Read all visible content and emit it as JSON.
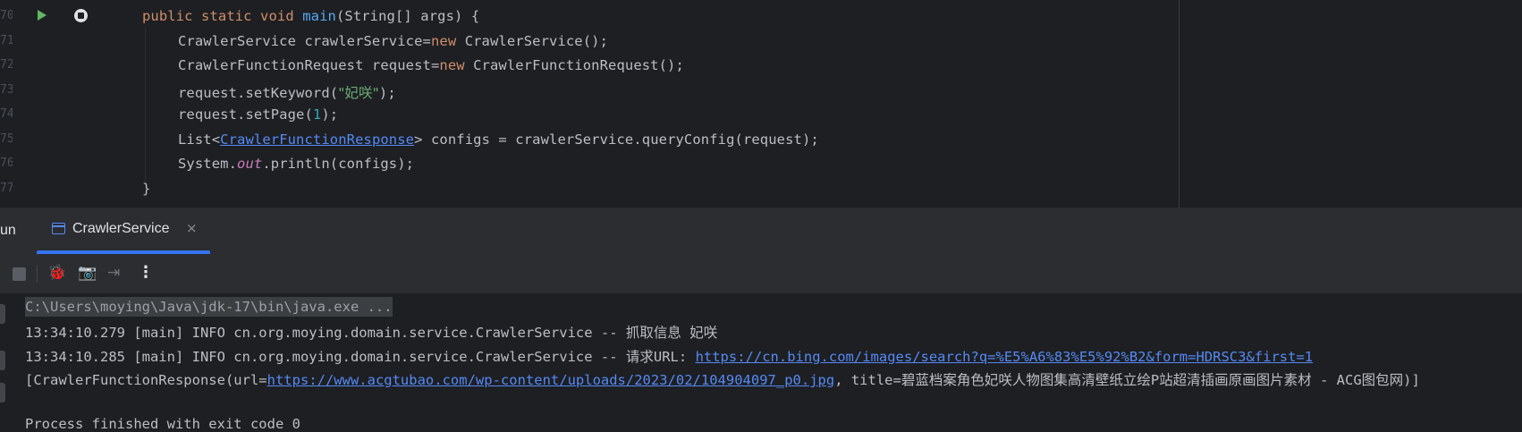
{
  "editor": {
    "line_numbers": [
      "70",
      "71",
      "72",
      "73",
      "74",
      "75",
      "76",
      "77"
    ],
    "code": {
      "l70": {
        "kw1": "public static void ",
        "method": "main",
        "rest": "(String[] args) {"
      },
      "l71": {
        "a": "CrawlerService crawlerService=",
        "kw": "new",
        "b": " CrawlerService();"
      },
      "l72": {
        "a": "CrawlerFunctionRequest request=",
        "kw": "new",
        "b": " CrawlerFunctionRequest();"
      },
      "l73": {
        "a": "request.setKeyword(",
        "str": "\"妃咲\"",
        "b": ");"
      },
      "l74": {
        "a": "request.setPage(",
        "num": "1",
        "b": ");"
      },
      "l75": {
        "a": "List<",
        "type_link": "CrawlerFunctionResponse",
        "b": "> configs = crawlerService.queryConfig(request);"
      },
      "l76": {
        "a": "System.",
        "field": "out",
        "b": ".println(configs);"
      },
      "l77": {
        "a": "}"
      }
    }
  },
  "run_panel": {
    "title": "un",
    "tab_label": "CrawlerService",
    "tab_close": "×",
    "toolbar_more": "⋮"
  },
  "console": {
    "command": "C:\\Users\\moying\\Java\\jdk-17\\bin\\java.exe ...",
    "log1": "13:34:10.279 [main] INFO cn.org.moying.domain.service.CrawlerService -- 抓取信息 妃咲",
    "log2_prefix": "13:34:10.285 [main] INFO cn.org.moying.domain.service.CrawlerService -- 请求URL: ",
    "log2_url": "https://cn.bing.com/images/search?q=%E5%A6%83%E5%92%B2&form=HDRSC3&first=1",
    "result_prefix": "[CrawlerFunctionResponse(url=",
    "result_url": "https://www.acgtubao.com/wp-content/uploads/2023/02/104904097_p0.jpg",
    "result_suffix": ", title=碧蓝档案角色妃咲人物图集高清壁纸立绘P站超清插画原画图片素材 - ACG图包网)]",
    "exit_line": "Process finished with exit code 0"
  },
  "colors": {
    "editor_bg": "#1e1f22",
    "panel_bg": "#2b2d30",
    "keyword": "#cf8e6d",
    "method": "#56a8f5",
    "string": "#6aab73",
    "number": "#2aacb8",
    "link": "#548af7",
    "accent": "#3574f0"
  }
}
